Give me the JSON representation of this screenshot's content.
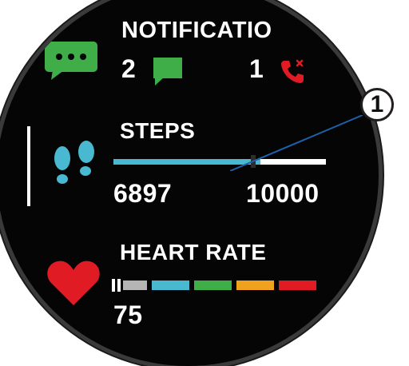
{
  "notifications": {
    "title": "NOTIFICATIO",
    "message_count": "2",
    "missed_call_count": "1"
  },
  "steps": {
    "title": "STEPS",
    "current": "6897",
    "goal": "10000",
    "progress": 0.69
  },
  "heart_rate": {
    "title": "HEART RATE",
    "value": "75",
    "zone_colors": [
      "#b5b5b5",
      "#49b9d1",
      "#3fae49",
      "#f0a21e",
      "#e01b23"
    ]
  },
  "callout": {
    "number": "1"
  },
  "icons": {
    "notifications": "chat-bubble-icon",
    "messages": "message-icon",
    "missed_call": "missed-call-icon",
    "steps": "footprints-icon",
    "heart_rate": "heart-icon"
  },
  "colors": {
    "accent_green": "#3fae49",
    "steps_blue": "#49b9d1",
    "heart_red": "#e01b23",
    "background": "#050505"
  }
}
